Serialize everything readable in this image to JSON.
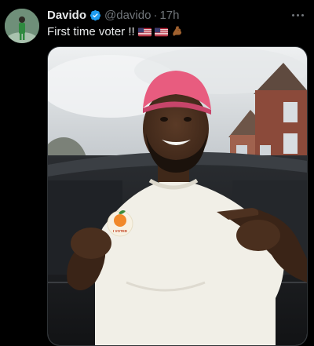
{
  "tweet": {
    "author_name": "Davido",
    "handle": "@davido",
    "separator": "·",
    "time": "17h",
    "text": "First time voter !!",
    "emojis": [
      "us-flag",
      "us-flag",
      "flexed-biceps"
    ]
  },
  "sticker_text": "I VOTED",
  "colors": {
    "background": "#000000",
    "primary_text": "#e7e9ea",
    "secondary_text": "#71767b",
    "verified_blue": "#1d9bf0"
  },
  "icons": {
    "verified": "verified-badge-icon",
    "more": "more-options-icon"
  }
}
